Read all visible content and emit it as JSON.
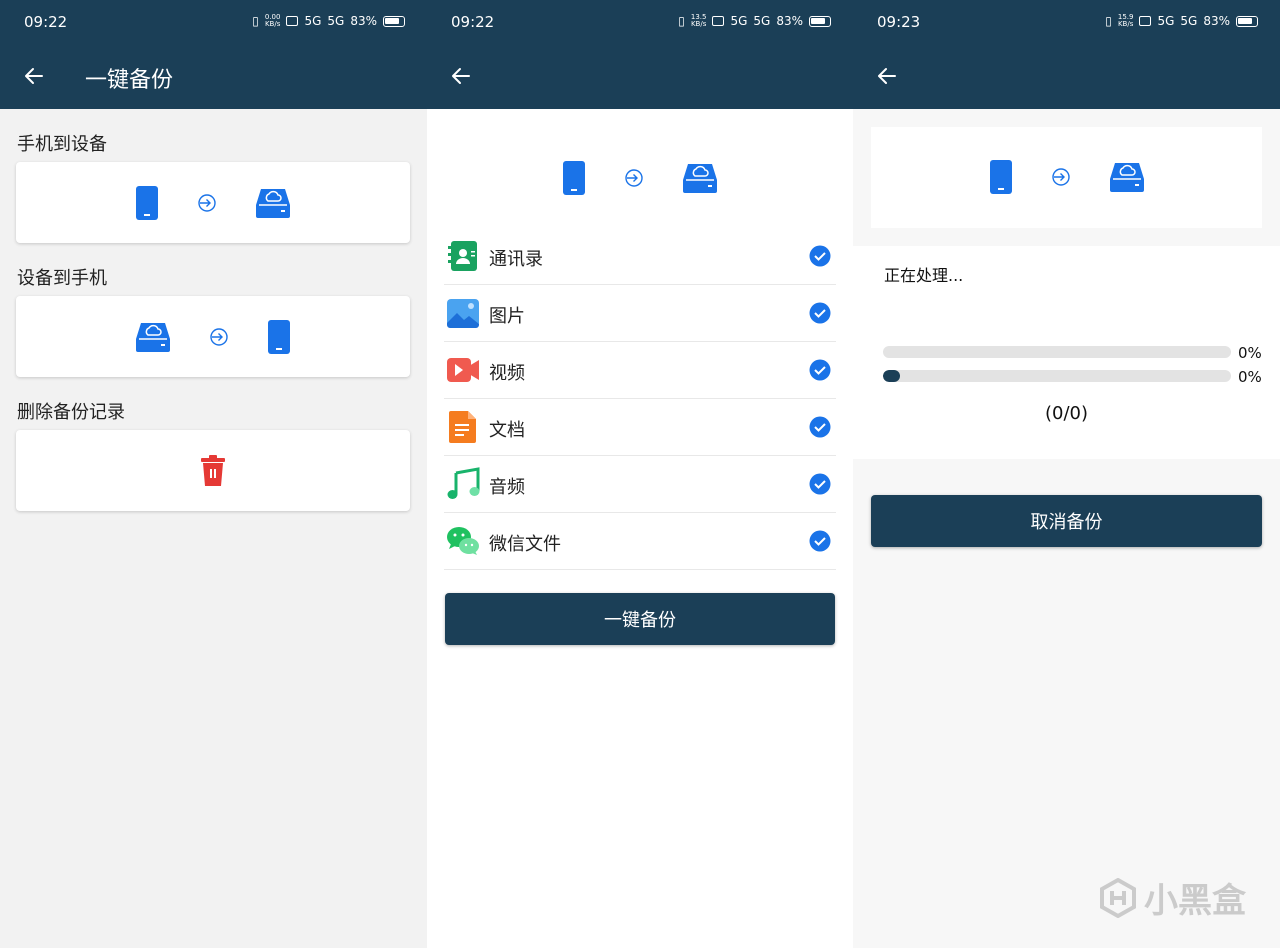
{
  "panel1": {
    "status": {
      "time": "09:22",
      "speed_top": "0.00",
      "speed_unit": "KB/s",
      "battery": "83%"
    },
    "title": "一键备份",
    "sections": [
      {
        "label": "手机到设备"
      },
      {
        "label": "设备到手机"
      },
      {
        "label": "删除备份记录"
      }
    ]
  },
  "panel2": {
    "status": {
      "time": "09:22",
      "speed_top": "13.5",
      "speed_unit": "KB/s",
      "battery": "83%"
    },
    "items": [
      {
        "label": "通讯录",
        "icon": "contacts-icon",
        "checked": true
      },
      {
        "label": "图片",
        "icon": "photos-icon",
        "checked": true
      },
      {
        "label": "视频",
        "icon": "video-icon",
        "checked": true
      },
      {
        "label": "文档",
        "icon": "document-icon",
        "checked": true
      },
      {
        "label": "音频",
        "icon": "audio-icon",
        "checked": true
      },
      {
        "label": "微信文件",
        "icon": "wechat-icon",
        "checked": true
      }
    ],
    "button": "一键备份"
  },
  "panel3": {
    "status": {
      "time": "09:23",
      "speed_top": "15.9",
      "speed_unit": "KB/s",
      "battery": "83%"
    },
    "processing": "正在处理...",
    "progress": [
      {
        "percent_label": "0%",
        "fill": 0
      },
      {
        "percent_label": "0%",
        "fill": 0.05
      }
    ],
    "count": "(0/0)",
    "button": "取消备份"
  },
  "watermark": "小黑盒",
  "colors": {
    "header": "#1b3f57",
    "blue": "#1a73e8",
    "check": "#1a73e8",
    "trash": "#e53935"
  }
}
